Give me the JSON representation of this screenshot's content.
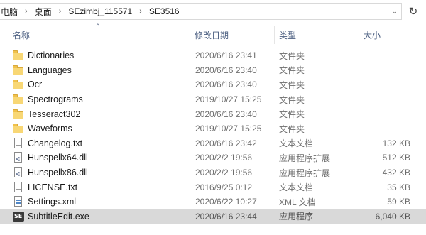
{
  "address_bar": {
    "crumbs": [
      "电脑",
      "桌面",
      "SEzimbj_115571",
      "SE3516"
    ],
    "separator": "›",
    "dropdown_glyph": "⌄",
    "refresh_glyph": "↻"
  },
  "columns": {
    "name": "名称",
    "date": "修改日期",
    "type": "类型",
    "size": "大小",
    "sort_glyph": "⌃"
  },
  "files": [
    {
      "name": "Dictionaries",
      "date": "2020/6/16 23:41",
      "type": "文件夹",
      "size": "",
      "icon": "folder-icon"
    },
    {
      "name": "Languages",
      "date": "2020/6/16 23:40",
      "type": "文件夹",
      "size": "",
      "icon": "folder-icon"
    },
    {
      "name": "Ocr",
      "date": "2020/6/16 23:40",
      "type": "文件夹",
      "size": "",
      "icon": "folder-icon"
    },
    {
      "name": "Spectrograms",
      "date": "2019/10/27 15:25",
      "type": "文件夹",
      "size": "",
      "icon": "folder-icon"
    },
    {
      "name": "Tesseract302",
      "date": "2020/6/16 23:40",
      "type": "文件夹",
      "size": "",
      "icon": "folder-icon"
    },
    {
      "name": "Waveforms",
      "date": "2019/10/27 15:25",
      "type": "文件夹",
      "size": "",
      "icon": "folder-icon"
    },
    {
      "name": "Changelog.txt",
      "date": "2020/6/16 23:42",
      "type": "文本文档",
      "size": "132 KB",
      "icon": "text-file-icon"
    },
    {
      "name": "Hunspellx64.dll",
      "date": "2020/2/2 19:56",
      "type": "应用程序扩展",
      "size": "512 KB",
      "icon": "dll-file-icon"
    },
    {
      "name": "Hunspellx86.dll",
      "date": "2020/2/2 19:56",
      "type": "应用程序扩展",
      "size": "432 KB",
      "icon": "dll-file-icon"
    },
    {
      "name": "LICENSE.txt",
      "date": "2016/9/25 0:12",
      "type": "文本文档",
      "size": "35 KB",
      "icon": "text-file-icon"
    },
    {
      "name": "Settings.xml",
      "date": "2020/6/22 10:27",
      "type": "XML 文档",
      "size": "59 KB",
      "icon": "xml-file-icon"
    },
    {
      "name": "SubtitleEdit.exe",
      "date": "2020/6/16 23:44",
      "type": "应用程序",
      "size": "6,040 KB",
      "icon": "exe-app-icon",
      "selected": true
    }
  ]
}
